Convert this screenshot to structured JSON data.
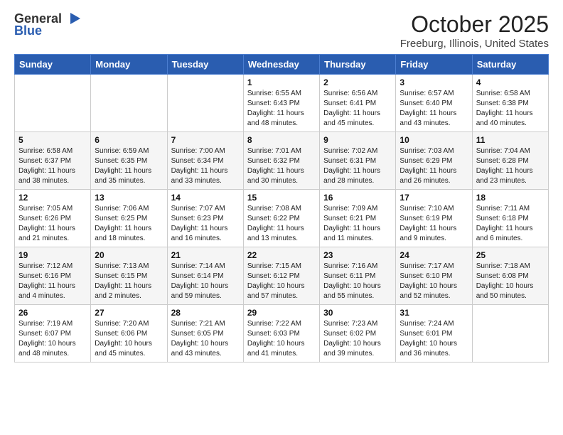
{
  "logo": {
    "general": "General",
    "blue": "Blue"
  },
  "title": "October 2025",
  "subtitle": "Freeburg, Illinois, United States",
  "days_of_week": [
    "Sunday",
    "Monday",
    "Tuesday",
    "Wednesday",
    "Thursday",
    "Friday",
    "Saturday"
  ],
  "weeks": [
    [
      {
        "day": "",
        "info": ""
      },
      {
        "day": "",
        "info": ""
      },
      {
        "day": "",
        "info": ""
      },
      {
        "day": "1",
        "info": "Sunrise: 6:55 AM\nSunset: 6:43 PM\nDaylight: 11 hours\nand 48 minutes."
      },
      {
        "day": "2",
        "info": "Sunrise: 6:56 AM\nSunset: 6:41 PM\nDaylight: 11 hours\nand 45 minutes."
      },
      {
        "day": "3",
        "info": "Sunrise: 6:57 AM\nSunset: 6:40 PM\nDaylight: 11 hours\nand 43 minutes."
      },
      {
        "day": "4",
        "info": "Sunrise: 6:58 AM\nSunset: 6:38 PM\nDaylight: 11 hours\nand 40 minutes."
      }
    ],
    [
      {
        "day": "5",
        "info": "Sunrise: 6:58 AM\nSunset: 6:37 PM\nDaylight: 11 hours\nand 38 minutes."
      },
      {
        "day": "6",
        "info": "Sunrise: 6:59 AM\nSunset: 6:35 PM\nDaylight: 11 hours\nand 35 minutes."
      },
      {
        "day": "7",
        "info": "Sunrise: 7:00 AM\nSunset: 6:34 PM\nDaylight: 11 hours\nand 33 minutes."
      },
      {
        "day": "8",
        "info": "Sunrise: 7:01 AM\nSunset: 6:32 PM\nDaylight: 11 hours\nand 30 minutes."
      },
      {
        "day": "9",
        "info": "Sunrise: 7:02 AM\nSunset: 6:31 PM\nDaylight: 11 hours\nand 28 minutes."
      },
      {
        "day": "10",
        "info": "Sunrise: 7:03 AM\nSunset: 6:29 PM\nDaylight: 11 hours\nand 26 minutes."
      },
      {
        "day": "11",
        "info": "Sunrise: 7:04 AM\nSunset: 6:28 PM\nDaylight: 11 hours\nand 23 minutes."
      }
    ],
    [
      {
        "day": "12",
        "info": "Sunrise: 7:05 AM\nSunset: 6:26 PM\nDaylight: 11 hours\nand 21 minutes."
      },
      {
        "day": "13",
        "info": "Sunrise: 7:06 AM\nSunset: 6:25 PM\nDaylight: 11 hours\nand 18 minutes."
      },
      {
        "day": "14",
        "info": "Sunrise: 7:07 AM\nSunset: 6:23 PM\nDaylight: 11 hours\nand 16 minutes."
      },
      {
        "day": "15",
        "info": "Sunrise: 7:08 AM\nSunset: 6:22 PM\nDaylight: 11 hours\nand 13 minutes."
      },
      {
        "day": "16",
        "info": "Sunrise: 7:09 AM\nSunset: 6:21 PM\nDaylight: 11 hours\nand 11 minutes."
      },
      {
        "day": "17",
        "info": "Sunrise: 7:10 AM\nSunset: 6:19 PM\nDaylight: 11 hours\nand 9 minutes."
      },
      {
        "day": "18",
        "info": "Sunrise: 7:11 AM\nSunset: 6:18 PM\nDaylight: 11 hours\nand 6 minutes."
      }
    ],
    [
      {
        "day": "19",
        "info": "Sunrise: 7:12 AM\nSunset: 6:16 PM\nDaylight: 11 hours\nand 4 minutes."
      },
      {
        "day": "20",
        "info": "Sunrise: 7:13 AM\nSunset: 6:15 PM\nDaylight: 11 hours\nand 2 minutes."
      },
      {
        "day": "21",
        "info": "Sunrise: 7:14 AM\nSunset: 6:14 PM\nDaylight: 10 hours\nand 59 minutes."
      },
      {
        "day": "22",
        "info": "Sunrise: 7:15 AM\nSunset: 6:12 PM\nDaylight: 10 hours\nand 57 minutes."
      },
      {
        "day": "23",
        "info": "Sunrise: 7:16 AM\nSunset: 6:11 PM\nDaylight: 10 hours\nand 55 minutes."
      },
      {
        "day": "24",
        "info": "Sunrise: 7:17 AM\nSunset: 6:10 PM\nDaylight: 10 hours\nand 52 minutes."
      },
      {
        "day": "25",
        "info": "Sunrise: 7:18 AM\nSunset: 6:08 PM\nDaylight: 10 hours\nand 50 minutes."
      }
    ],
    [
      {
        "day": "26",
        "info": "Sunrise: 7:19 AM\nSunset: 6:07 PM\nDaylight: 10 hours\nand 48 minutes."
      },
      {
        "day": "27",
        "info": "Sunrise: 7:20 AM\nSunset: 6:06 PM\nDaylight: 10 hours\nand 45 minutes."
      },
      {
        "day": "28",
        "info": "Sunrise: 7:21 AM\nSunset: 6:05 PM\nDaylight: 10 hours\nand 43 minutes."
      },
      {
        "day": "29",
        "info": "Sunrise: 7:22 AM\nSunset: 6:03 PM\nDaylight: 10 hours\nand 41 minutes."
      },
      {
        "day": "30",
        "info": "Sunrise: 7:23 AM\nSunset: 6:02 PM\nDaylight: 10 hours\nand 39 minutes."
      },
      {
        "day": "31",
        "info": "Sunrise: 7:24 AM\nSunset: 6:01 PM\nDaylight: 10 hours\nand 36 minutes."
      },
      {
        "day": "",
        "info": ""
      }
    ]
  ]
}
